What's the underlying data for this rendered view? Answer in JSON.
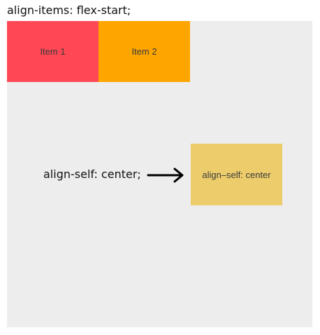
{
  "title": "align-items: flex-start;",
  "items": [
    {
      "label": "Item 1",
      "color": "#ff4755"
    },
    {
      "label": "Item 2",
      "color": "#ffa500"
    },
    {
      "label": "align–self: center",
      "color": "#eccc6b"
    }
  ],
  "annotation": "align-self: center;",
  "container_color": "#ededed",
  "arrow_icon": "right-arrow-icon"
}
